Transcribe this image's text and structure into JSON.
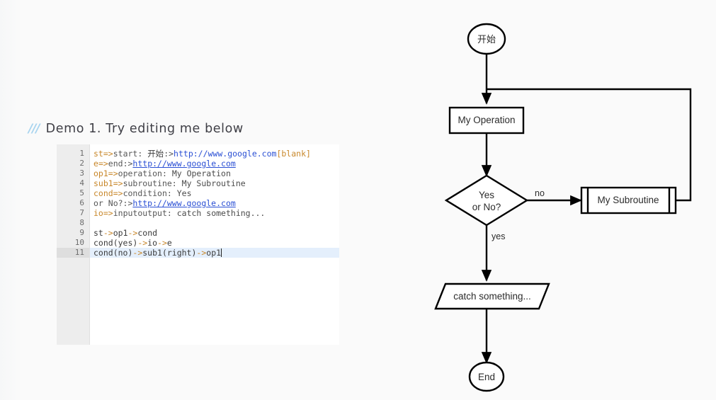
{
  "page": {
    "background_color": "#fafafa"
  },
  "editor_panel": {
    "title": "Demo 1. Try editing me below",
    "title_marker": "///",
    "marker_color": "#a8d4ef",
    "active_line": 11,
    "gutter_color": "#ededed",
    "active_line_color": "#e4effc",
    "line_numbers": [
      "1",
      "2",
      "3",
      "4",
      "5",
      "6",
      "7",
      "8",
      "9",
      "10",
      "11"
    ],
    "lines": [
      {
        "n": "1",
        "raw": "st=>start: 开始:>http://www.google.com[blank]"
      },
      {
        "n": "2",
        "raw": "e=>end:>http://www.google.com"
      },
      {
        "n": "3",
        "raw": "op1=>operation: My Operation"
      },
      {
        "n": "4",
        "raw": "sub1=>subroutine: My Subroutine"
      },
      {
        "n": "5",
        "raw": "cond=>condition: Yes"
      },
      {
        "n": "6",
        "raw": "or No?:>http://www.google.com"
      },
      {
        "n": "7",
        "raw": "io=>inputoutput: catch something..."
      },
      {
        "n": "8",
        "raw": ""
      },
      {
        "n": "9",
        "raw": "st->op1->cond"
      },
      {
        "n": "10",
        "raw": "cond(yes)->io->e"
      },
      {
        "n": "11",
        "raw": "cond(no)->sub1(right)->op1"
      }
    ],
    "tokens": {
      "l1_id": "st",
      "l1_arrow": "=>",
      "l1_kw": "start: ",
      "l1_cn": "开始",
      "l1_colon": ":>",
      "l1_url": "http://www.google.com",
      "l1_brk": "[blank]",
      "l2_id": "e",
      "l2_arrow": "=>",
      "l2_kw": "end:>",
      "l2_url": "http://www.google.com",
      "l3_id": "op1",
      "l3_arrow": "=>",
      "l3_kw": "operation: ",
      "l3_txt": "My Operation",
      "l4_id": "sub1",
      "l4_arrow": "=>",
      "l4_kw": "subroutine: ",
      "l4_txt": "My Subroutine",
      "l5_id": "cond",
      "l5_arrow": "=>",
      "l5_kw": "condition: ",
      "l5_txt": "Yes",
      "l6_kw": "or No?:>",
      "l6_url": "http://www.google.com",
      "l7_id": "io",
      "l7_arrow": "=>",
      "l7_kw": "inputoutput: ",
      "l7_txt": "catch something...",
      "l9_a": "st",
      "l9_ar1": "->",
      "l9_b": "op1",
      "l9_ar2": "->",
      "l9_c": "cond",
      "l10_a": "cond(yes)",
      "l10_ar1": "->",
      "l10_b": "io",
      "l10_ar2": "->",
      "l10_c": "e",
      "l11_a": "cond(no)",
      "l11_ar1": "->",
      "l11_b": "sub1(right)",
      "l11_ar2": "->",
      "l11_c": "op1"
    }
  },
  "flowchart": {
    "nodes": {
      "start": {
        "label": "开始",
        "shape": "ellipse"
      },
      "operation": {
        "label": "My Operation",
        "shape": "rectangle"
      },
      "condition": {
        "label_line1": "Yes",
        "label_line2": "or No?",
        "shape": "diamond"
      },
      "subroutine": {
        "label": "My Subroutine",
        "shape": "subroutine"
      },
      "inputoutput": {
        "label": "catch something...",
        "shape": "parallelogram"
      },
      "end": {
        "label": "End",
        "shape": "ellipse"
      }
    },
    "edge_labels": {
      "no": "no",
      "yes": "yes"
    },
    "stroke_color": "#000000",
    "fill_color": "#ffffff"
  }
}
